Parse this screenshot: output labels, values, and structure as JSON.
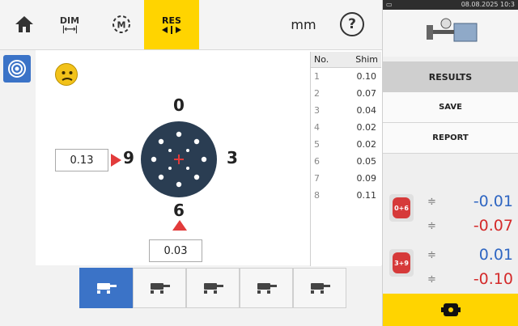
{
  "toolbar": {
    "dim_label": "DIM",
    "mode_label": "M",
    "res_label": "RES",
    "units": "mm",
    "help": "?"
  },
  "diagram": {
    "top_label": "0",
    "right_label": "3",
    "bottom_label": "6",
    "left_label": "9",
    "left_value": "0.13",
    "bottom_value": "0.03"
  },
  "shim_table": {
    "col_no": "No.",
    "col_shim": "Shim",
    "rows": [
      {
        "no": "1",
        "val": "0.10"
      },
      {
        "no": "2",
        "val": "0.07"
      },
      {
        "no": "3",
        "val": "0.04"
      },
      {
        "no": "4",
        "val": "0.02"
      },
      {
        "no": "5",
        "val": "0.02"
      },
      {
        "no": "6",
        "val": "0.05"
      },
      {
        "no": "7",
        "val": "0.09"
      },
      {
        "no": "8",
        "val": "0.11"
      }
    ]
  },
  "right_panel": {
    "status_time": "08.08.2025 10:3",
    "results_label": "RESULTS",
    "save_label": "SAVE",
    "report_label": "REPORT",
    "vertical_badge": "0+6",
    "vertical_offset": "-0.01",
    "vertical_angularity": "-0.07",
    "horizontal_badge": "3+9",
    "horizontal_offset": "0.01",
    "horizontal_angularity": "-0.10"
  },
  "colors": {
    "accent_yellow": "#ffd400",
    "accent_blue": "#3b73c7",
    "value_blue": "#2f66c2",
    "value_red": "#d42a2a",
    "flange_dark": "#2a3d52"
  }
}
